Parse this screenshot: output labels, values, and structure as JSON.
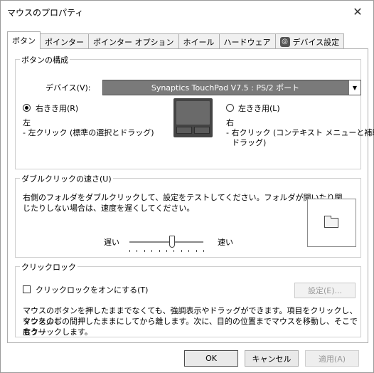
{
  "window": {
    "title": "マウスのプロパティ",
    "close_glyph": "✕"
  },
  "tabs": [
    {
      "label": "ボタン"
    },
    {
      "label": "ポインター"
    },
    {
      "label": "ポインター オプション"
    },
    {
      "label": "ホイール"
    },
    {
      "label": "ハードウェア"
    },
    {
      "label": "デバイス設定"
    }
  ],
  "button_config": {
    "group_title": "ボタンの構成",
    "device_label": "デバイス(V):",
    "device_value": "Synaptics TouchPad V7.5 : PS/2 ポート",
    "right_hand_label": "右きき用(R)",
    "left_hand_label": "左きき用(L)",
    "left_heading": "左",
    "left_desc": "- 左クリック (標準の選択とドラッグ)",
    "right_heading": "右",
    "right_desc_1": "- 右クリック (コンテキスト メニューと補助",
    "right_desc_2": "ドラッグ)"
  },
  "double_click": {
    "group_title": "ダブルクリックの速さ(U)",
    "instruction_1": "右側のフォルダをダブルクリックして、設定をテストしてください。フォルダが開いたり閉",
    "instruction_2": "じたりしない場合は、速度を遅くしてください。",
    "slow_label": "遅い",
    "fast_label": "速い",
    "speed_fraction": 0.58
  },
  "click_lock": {
    "group_title": "クリックロック",
    "checkbox_label": "クリックロックをオンにする(T)",
    "settings_button": "設定(E)...",
    "desc_1": "マウスのボタンを押したままでなくても、強調表示やドラッグができます。項目をクリックし、マウスのボ",
    "desc_2": "タンを少しの間押したままにしてから離します。次に、目的の位置までマウスを移動し、そこでもう一",
    "desc_3": "度クリックします。"
  },
  "footer": {
    "ok": "OK",
    "cancel": "キャンセル",
    "apply": "適用(A)"
  }
}
